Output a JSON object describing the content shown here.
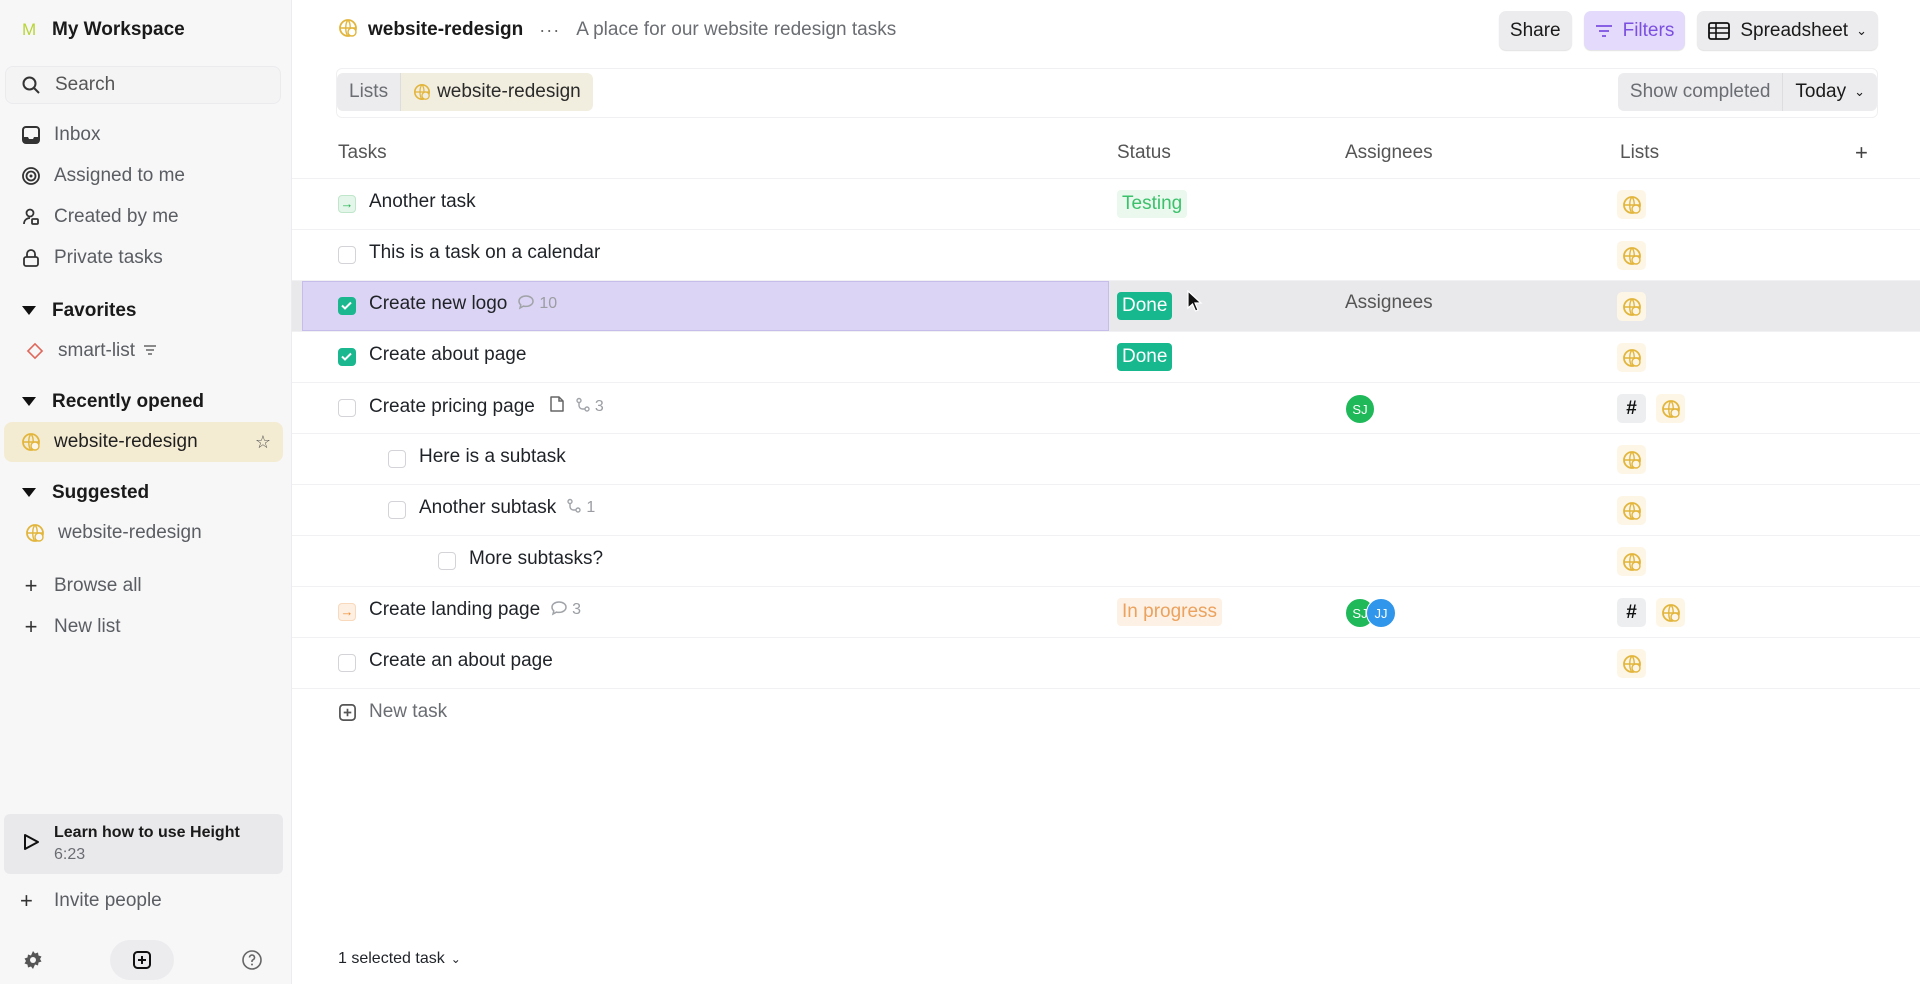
{
  "colors": {
    "accent": "#7b4fe0",
    "done": "#17b88e",
    "testing": "#3cc16b",
    "in_progress": "#eba25e",
    "list_icon": "#e2b53c",
    "av_sj": "#1fb95a",
    "av_jj": "#2f96eb"
  },
  "sidebar": {
    "workspace_initial": "M",
    "workspace_name": "My Workspace",
    "search_placeholder": "Search",
    "nav": [
      {
        "label": "Inbox",
        "icon": "inbox-icon"
      },
      {
        "label": "Assigned to me",
        "icon": "target-icon"
      },
      {
        "label": "Created by me",
        "icon": "user-created-icon"
      },
      {
        "label": "Private tasks",
        "icon": "lock-icon"
      }
    ],
    "favorites": {
      "title": "Favorites",
      "items": [
        {
          "label": "smart-list",
          "icon": "diamond-icon"
        }
      ]
    },
    "recent": {
      "title": "Recently opened",
      "items": [
        {
          "label": "website-redesign",
          "icon": "globe-icon"
        }
      ]
    },
    "suggested": {
      "title": "Suggested",
      "items": [
        {
          "label": "website-redesign",
          "icon": "globe-icon"
        }
      ]
    },
    "browse_all": "Browse all",
    "new_list": "New list",
    "learn": {
      "title": "Learn how to use Height",
      "duration": "6:23"
    },
    "invite": "Invite people"
  },
  "header": {
    "title": "website-redesign",
    "description": "A place for our website redesign tasks",
    "share": "Share",
    "filters": "Filters",
    "view": "Spreadsheet"
  },
  "filterbar": {
    "crumb_root": "Lists",
    "crumb_current": "website-redesign",
    "show_completed": "Show completed",
    "today": "Today"
  },
  "table": {
    "columns": {
      "tasks": "Tasks",
      "status": "Status",
      "assignees": "Assignees",
      "lists": "Lists"
    },
    "rows": [
      {
        "name": "Another task",
        "state": "testing",
        "status": "Testing",
        "indent": 0
      },
      {
        "name": "This is a task on a calendar",
        "state": "open",
        "status": "",
        "indent": 0
      },
      {
        "name": "Create new logo",
        "state": "done",
        "status": "Done",
        "comments": "10",
        "assignees_placeholder": "Assignees",
        "indent": 0,
        "selected": true
      },
      {
        "name": "Create about page",
        "state": "done",
        "status": "Done",
        "indent": 0
      },
      {
        "name": "Create pricing page",
        "state": "open",
        "status": "",
        "subtasks": "3",
        "has_doc": true,
        "assignees": [
          "SJ"
        ],
        "indent": 0
      },
      {
        "name": "Here is a subtask",
        "state": "open",
        "status": "",
        "indent": 1
      },
      {
        "name": "Another subtask",
        "state": "open",
        "status": "",
        "subtasks": "1",
        "indent": 1
      },
      {
        "name": "More subtasks?",
        "state": "open",
        "status": "",
        "indent": 2
      },
      {
        "name": "Create landing page",
        "state": "progress",
        "status": "In progress",
        "comments": "3",
        "assignees": [
          "SJ",
          "JJ"
        ],
        "indent": 0
      },
      {
        "name": "Create an about page",
        "state": "open",
        "status": "",
        "indent": 0
      }
    ],
    "new_task": "New task"
  },
  "footer": {
    "selected": "1 selected task"
  }
}
